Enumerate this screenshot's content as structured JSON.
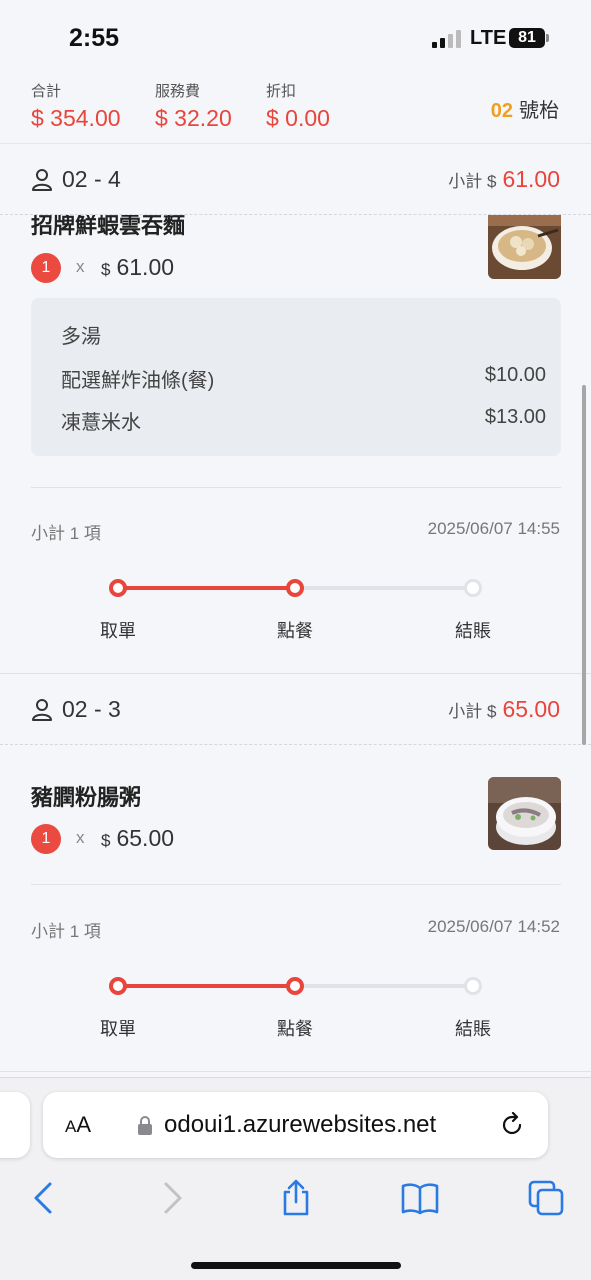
{
  "status_bar": {
    "time": "2:55",
    "network": "LTE",
    "battery": "81"
  },
  "summary": {
    "total_label": "合計",
    "total_value": "$ 354.00",
    "service_label": "服務費",
    "service_value": "$ 32.20",
    "discount_label": "折扣",
    "discount_value": "$ 0.00",
    "table_number": "02",
    "table_suffix": "號枱"
  },
  "orders": [
    {
      "id": "02 - 4",
      "subtotal_label": "小計 $",
      "subtotal_value": "61.00",
      "item": {
        "name": "招牌鮮蝦雲吞麵",
        "qty": "1",
        "times": "x",
        "currency": "$",
        "price": "61.00"
      },
      "options": [
        {
          "label": "多湯",
          "price": ""
        },
        {
          "label": "配選鮮炸油條(餐)",
          "price": "$10.00"
        },
        {
          "label": "凍薏米水",
          "price": "$13.00"
        }
      ],
      "count_text": "小計 1 項",
      "timestamp": "2025/06/07 14:55",
      "steps": [
        "取單",
        "點餐",
        "結賬"
      ],
      "progress_completed_steps": 2
    },
    {
      "id": "02 - 3",
      "subtotal_label": "小計 $",
      "subtotal_value": "65.00",
      "item": {
        "name": "豬膶粉腸粥",
        "qty": "1",
        "times": "x",
        "currency": "$",
        "price": "65.00"
      },
      "count_text": "小計 1 項",
      "timestamp": "2025/06/07 14:52",
      "steps": [
        "取單",
        "點餐",
        "結賬"
      ],
      "progress_completed_steps": 2
    }
  ],
  "browser": {
    "aa_label": "AA",
    "url": "odoui1.azurewebsites.net"
  },
  "colors": {
    "accent": "#e8453c",
    "table_number": "#f0a020",
    "inactive": "#dfe3e7"
  },
  "icons": [
    "person-icon",
    "lock-icon",
    "reload-icon",
    "back-icon",
    "forward-icon",
    "share-icon",
    "bookmarks-icon",
    "tabs-icon"
  ]
}
